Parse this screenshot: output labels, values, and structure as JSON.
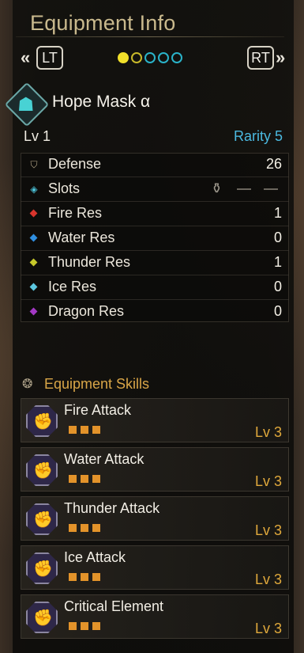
{
  "header": {
    "title": "Equipment Info",
    "left_key": "LT",
    "right_key": "RT",
    "left_arrow": "«",
    "right_arrow": "»",
    "page_count": 5,
    "page_current": 1
  },
  "item": {
    "name": "Hope Mask α",
    "icon": "head-armor-icon",
    "level": "Lv 1",
    "rarity": "Rarity 5"
  },
  "stats": [
    {
      "label": "Defense",
      "value": "26",
      "icon": "shield-icon"
    },
    {
      "label": "Slots",
      "value": "",
      "icon": "slot-gem-icon",
      "slots": [
        "—",
        "—"
      ]
    },
    {
      "label": "Fire Res",
      "value": "1",
      "icon": "fire-diamond-icon",
      "color": "#d8342c"
    },
    {
      "label": "Water Res",
      "value": "0",
      "icon": "water-diamond-icon",
      "color": "#2f8ee0"
    },
    {
      "label": "Thunder Res",
      "value": "1",
      "icon": "thunder-diamond-icon",
      "color": "#c6c82a"
    },
    {
      "label": "Ice Res",
      "value": "0",
      "icon": "ice-diamond-icon",
      "color": "#5cc7e0"
    },
    {
      "label": "Dragon Res",
      "value": "0",
      "icon": "dragon-diamond-icon",
      "color": "#a338c4"
    }
  ],
  "skills_section": {
    "title": "Equipment Skills"
  },
  "skills": [
    {
      "name": "Fire Attack",
      "level": "Lv 3",
      "pips": 3
    },
    {
      "name": "Water Attack",
      "level": "Lv 3",
      "pips": 3
    },
    {
      "name": "Thunder Attack",
      "level": "Lv 3",
      "pips": 3
    },
    {
      "name": "Ice Attack",
      "level": "Lv 3",
      "pips": 3
    },
    {
      "name": "Critical Element",
      "level": "Lv 3",
      "pips": 3
    }
  ],
  "colors": {
    "title": "#c9b98d",
    "rarity": "#4bb9e0",
    "skill_accent": "#d9a648",
    "pip": "#e3932a",
    "page_dot_active": "#f1e02a",
    "page_dot": "#2ab3c9"
  }
}
